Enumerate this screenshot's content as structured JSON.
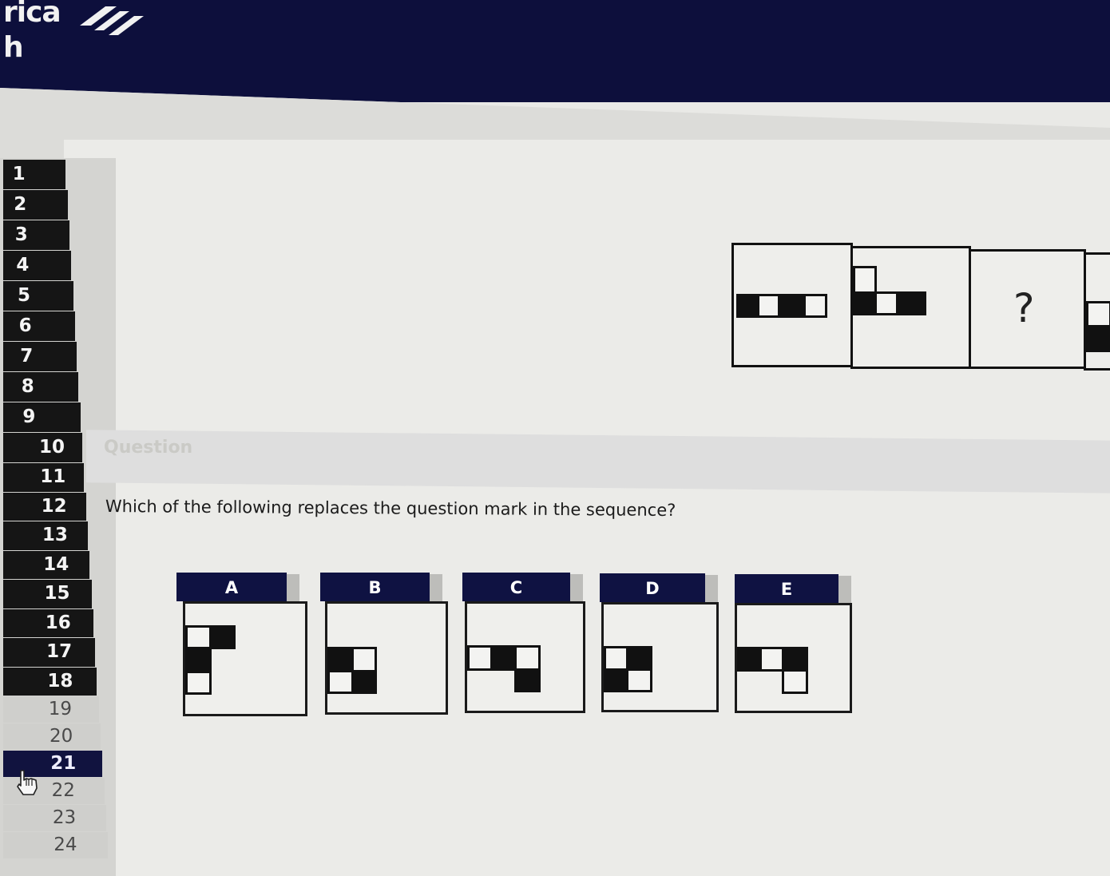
{
  "header": {
    "brand_line1": "rica",
    "brand_line2": "h",
    "logo_icon": "flag-stripes-logo-icon"
  },
  "sidebar": {
    "items": [
      "1",
      "2",
      "3",
      "4",
      "5",
      "6",
      "7",
      "8",
      "9",
      "10",
      "11",
      "12",
      "13",
      "14",
      "15",
      "16",
      "17",
      "18",
      "19",
      "20",
      "21",
      "22",
      "23",
      "24"
    ],
    "answered_through": 18,
    "current": "21"
  },
  "question": {
    "section_label": "Question",
    "text": "Which of the following replaces the question mark in the sequence?",
    "sequence_placeholder": "?"
  },
  "options": [
    {
      "label": "A"
    },
    {
      "label": "B"
    },
    {
      "label": "C"
    },
    {
      "label": "D"
    },
    {
      "label": "E"
    }
  ],
  "colors": {
    "header": "#0d0f3c",
    "tab": "#0f1242",
    "answered": "#151515",
    "unanswered": "#cfcfcc"
  },
  "cursor_icon": "hand-pointer-icon"
}
